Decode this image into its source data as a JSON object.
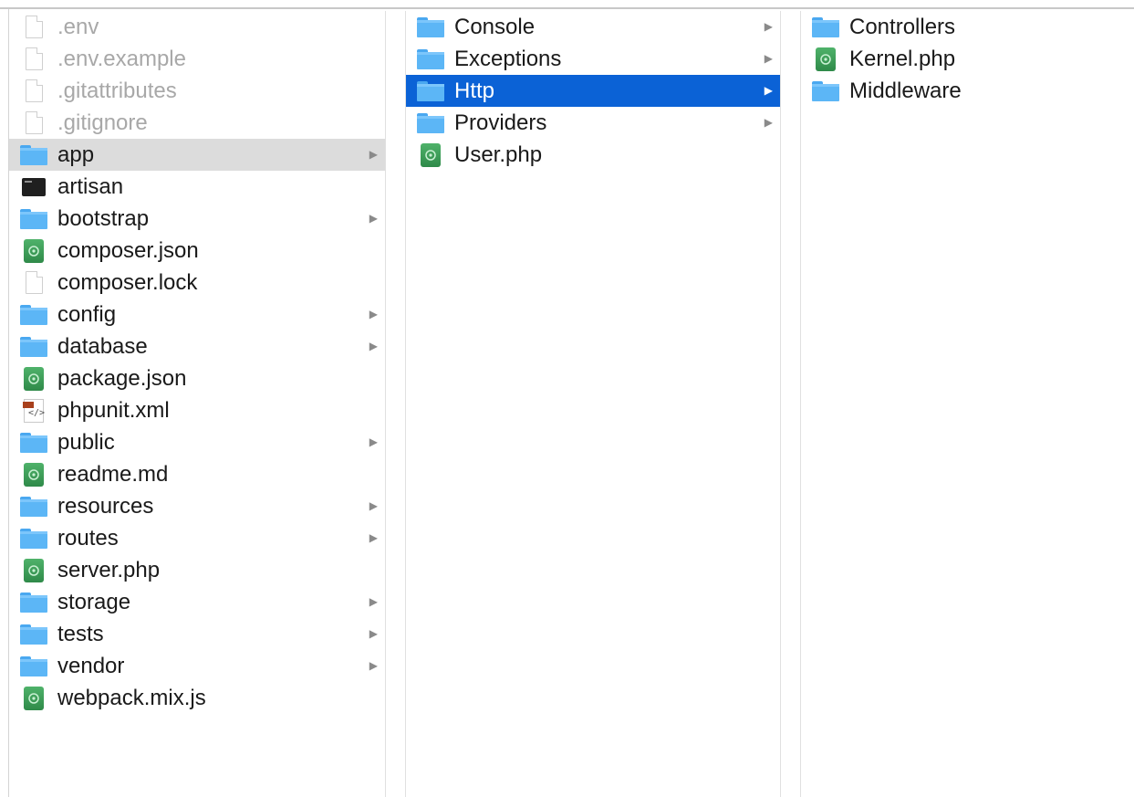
{
  "columns": [
    {
      "items": [
        {
          "label": ".env",
          "icon": "file-icon",
          "kind": "file",
          "hidden": true
        },
        {
          "label": ".env.example",
          "icon": "file-icon",
          "kind": "file",
          "hidden": true
        },
        {
          "label": ".gitattributes",
          "icon": "file-icon",
          "kind": "file",
          "hidden": true
        },
        {
          "label": ".gitignore",
          "icon": "file-icon",
          "kind": "file",
          "hidden": true
        },
        {
          "label": "app",
          "icon": "folder-icon",
          "kind": "folder",
          "state": "parent",
          "chevron": "▶"
        },
        {
          "label": "artisan",
          "icon": "terminal-icon",
          "kind": "terminal"
        },
        {
          "label": "bootstrap",
          "icon": "folder-icon",
          "kind": "folder",
          "chevron": "▶"
        },
        {
          "label": "composer.json",
          "icon": "code-file-icon",
          "kind": "code"
        },
        {
          "label": "composer.lock",
          "icon": "file-icon",
          "kind": "file"
        },
        {
          "label": "config",
          "icon": "folder-icon",
          "kind": "folder",
          "chevron": "▶"
        },
        {
          "label": "database",
          "icon": "folder-icon",
          "kind": "folder",
          "chevron": "▶"
        },
        {
          "label": "package.json",
          "icon": "code-file-icon",
          "kind": "code"
        },
        {
          "label": "phpunit.xml",
          "icon": "xml-file-icon",
          "kind": "xml"
        },
        {
          "label": "public",
          "icon": "folder-icon",
          "kind": "folder",
          "chevron": "▶"
        },
        {
          "label": "readme.md",
          "icon": "code-file-icon",
          "kind": "code"
        },
        {
          "label": "resources",
          "icon": "folder-icon",
          "kind": "folder",
          "chevron": "▶"
        },
        {
          "label": "routes",
          "icon": "folder-icon",
          "kind": "folder",
          "chevron": "▶"
        },
        {
          "label": "server.php",
          "icon": "code-file-icon",
          "kind": "code"
        },
        {
          "label": "storage",
          "icon": "folder-icon",
          "kind": "folder",
          "chevron": "▶"
        },
        {
          "label": "tests",
          "icon": "folder-icon",
          "kind": "folder",
          "chevron": "▶"
        },
        {
          "label": "vendor",
          "icon": "folder-icon",
          "kind": "folder",
          "chevron": "▶"
        },
        {
          "label": "webpack.mix.js",
          "icon": "code-file-icon",
          "kind": "code"
        }
      ]
    },
    {
      "items": [
        {
          "label": "Console",
          "icon": "folder-icon",
          "kind": "folder",
          "chevron": "▶"
        },
        {
          "label": "Exceptions",
          "icon": "folder-icon",
          "kind": "folder",
          "chevron": "▶"
        },
        {
          "label": "Http",
          "icon": "folder-icon",
          "kind": "folder",
          "state": "selected",
          "chevron": "▶"
        },
        {
          "label": "Providers",
          "icon": "folder-icon",
          "kind": "folder",
          "chevron": "▶"
        },
        {
          "label": "User.php",
          "icon": "code-file-icon",
          "kind": "code"
        }
      ]
    },
    {
      "items": [
        {
          "label": "Controllers",
          "icon": "folder-icon",
          "kind": "folder"
        },
        {
          "label": "Kernel.php",
          "icon": "code-file-icon",
          "kind": "code"
        },
        {
          "label": "Middleware",
          "icon": "folder-icon",
          "kind": "folder"
        }
      ]
    }
  ],
  "colors": {
    "selection": "#0b62d6",
    "parent_highlight": "#dcdcdc",
    "folder": "#5cb6f6",
    "hidden_text": "#a8a8a8"
  }
}
